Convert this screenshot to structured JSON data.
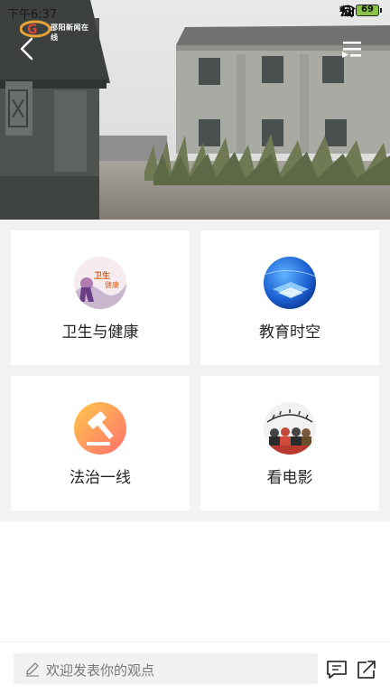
{
  "status_bar": {
    "time": "下午6:37",
    "battery": "69"
  },
  "player": {
    "logo_text": "邵阳新闻在线",
    "back_icon": "chevron-left-icon",
    "playlist_icon": "playlist-icon"
  },
  "categories": [
    {
      "label": "卫生与健康",
      "icon": "health-thumb"
    },
    {
      "label": "教育时空",
      "icon": "education-thumb"
    },
    {
      "label": "法治一线",
      "icon": "gavel-thumb"
    },
    {
      "label": "看电影",
      "icon": "movie-thumb"
    }
  ],
  "comment_bar": {
    "placeholder": "欢迎发表你的观点",
    "comment_icon": "comment-icon",
    "share_icon": "share-icon"
  }
}
